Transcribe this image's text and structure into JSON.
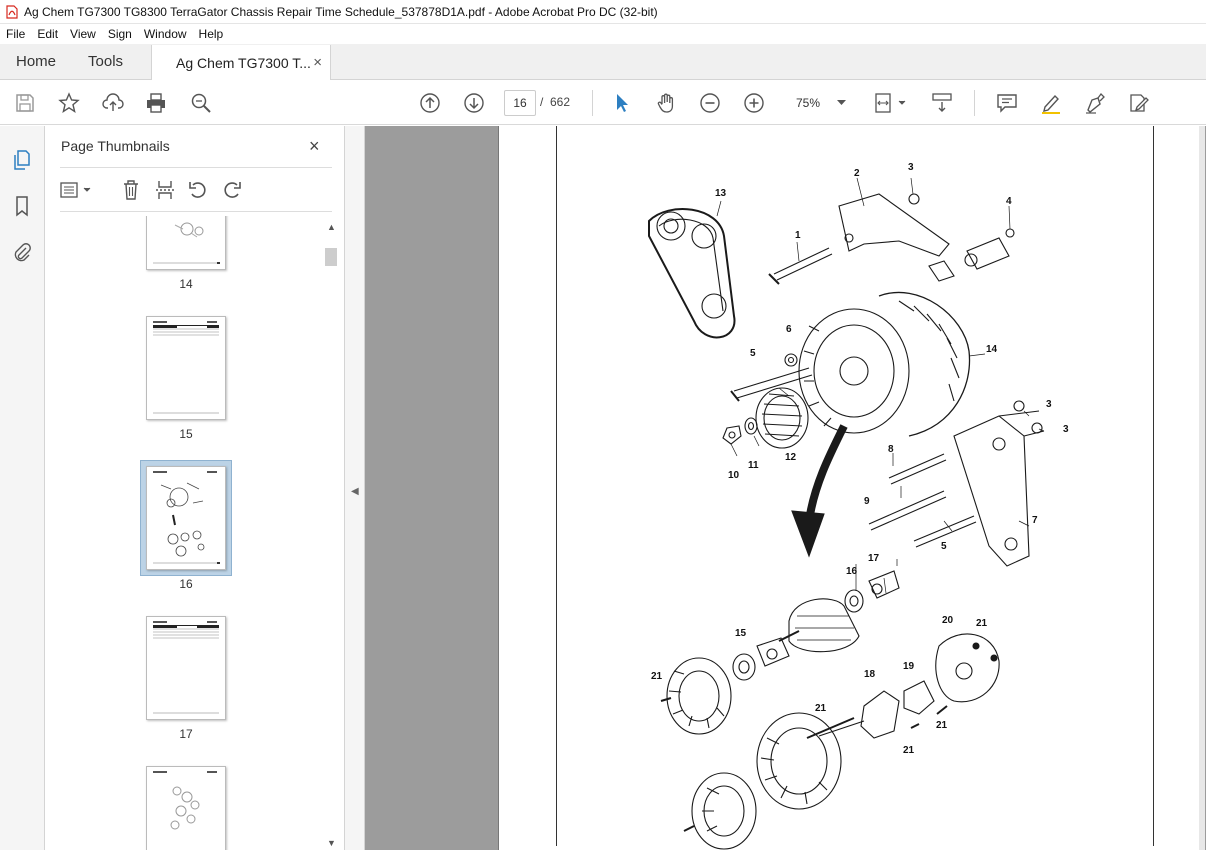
{
  "window": {
    "title": "Ag Chem TG7300 TG8300 TerraGator Chassis Repair Time Schedule_537878D1A.pdf - Adobe Acrobat Pro DC (32-bit)"
  },
  "menu": [
    "File",
    "Edit",
    "View",
    "Sign",
    "Window",
    "Help"
  ],
  "tabs": {
    "home": "Home",
    "tools": "Tools",
    "document": "Ag Chem TG7300 T...",
    "close": "×"
  },
  "toolbar": {
    "current_page": "16",
    "page_separator": "/",
    "total_pages": "662",
    "zoom": "75%"
  },
  "thumbnails_panel": {
    "title": "Page Thumbnails",
    "close": "×",
    "pages": [
      {
        "label": "14",
        "selected": false
      },
      {
        "label": "15",
        "selected": false
      },
      {
        "label": "16",
        "selected": true
      },
      {
        "label": "17",
        "selected": false
      },
      {
        "label": "",
        "selected": false
      }
    ]
  },
  "diagram": {
    "callouts": [
      "1",
      "2",
      "3",
      "3",
      "3",
      "4",
      "5",
      "5",
      "6",
      "7",
      "8",
      "9",
      "10",
      "11",
      "12",
      "13",
      "14",
      "15",
      "16",
      "17",
      "18",
      "19",
      "20",
      "21",
      "21",
      "21",
      "21",
      "21"
    ]
  },
  "colors": {
    "accent_blue": "#2d7fc1",
    "acrobat_red": "#d7281e",
    "workspace_gray": "#9c9c9c",
    "selected_thumb": "#bcd3e6"
  }
}
